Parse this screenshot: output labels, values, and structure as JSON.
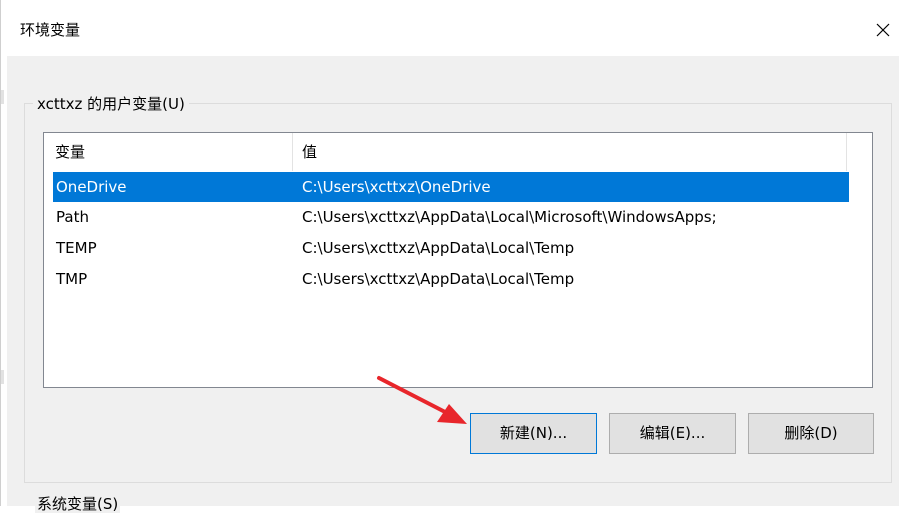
{
  "window": {
    "title": "环境变量",
    "close_glyph": "✕"
  },
  "user_vars": {
    "group_label": "xcttxz 的用户变量(U)",
    "columns": [
      "变量",
      "值"
    ],
    "rows": [
      {
        "name": "OneDrive",
        "value": "C:\\Users\\xcttxz\\OneDrive",
        "selected": true
      },
      {
        "name": "Path",
        "value": "C:\\Users\\xcttxz\\AppData\\Local\\Microsoft\\WindowsApps;",
        "selected": false
      },
      {
        "name": "TEMP",
        "value": "C:\\Users\\xcttxz\\AppData\\Local\\Temp",
        "selected": false
      },
      {
        "name": "TMP",
        "value": "C:\\Users\\xcttxz\\AppData\\Local\\Temp",
        "selected": false
      }
    ],
    "buttons": {
      "new_label": "新建(N)...",
      "edit_label": "编辑(E)...",
      "delete_label": "删除(D)"
    }
  },
  "system_vars": {
    "group_label": "系统变量(S)"
  },
  "colors": {
    "selection": "#0078d7",
    "annotation_arrow": "#e8262b"
  },
  "icons": {
    "close": "close-icon",
    "annotation": "red-arrow-annotation-icon"
  }
}
